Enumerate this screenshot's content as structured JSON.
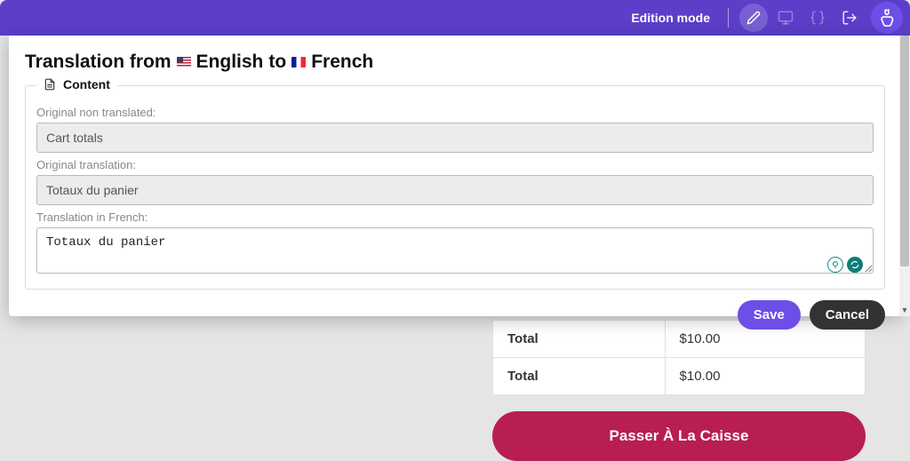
{
  "topbar": {
    "edition_mode": "Edition mode"
  },
  "modal": {
    "title_prefix": "Translation from ",
    "lang_from": "English",
    "to_word": " to ",
    "lang_to": "French",
    "legend": "Content",
    "label_original_non_translated": "Original non translated:",
    "value_original_non_translated": "Cart totals",
    "label_original_translation": "Original translation:",
    "value_original_translation": "Totaux du panier",
    "label_translation_in": "Translation in French:",
    "value_translation_in": "Totaux du panier",
    "save": "Save",
    "cancel": "Cancel"
  },
  "bg": {
    "rows": [
      {
        "label": "Total",
        "value": "$10.00"
      },
      {
        "label": "Total",
        "value": "$10.00"
      }
    ],
    "checkout": "Passer À La Caisse"
  }
}
